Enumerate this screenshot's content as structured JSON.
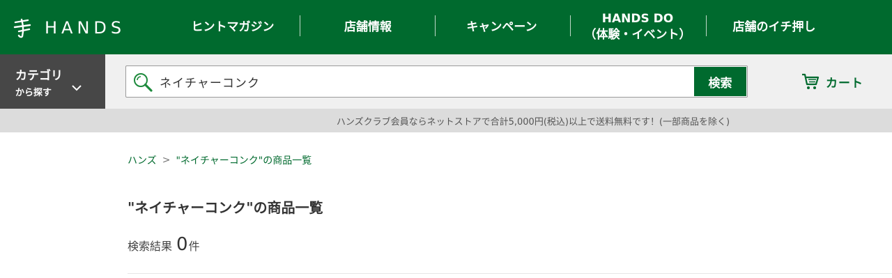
{
  "header": {
    "logo_text": "HANDS",
    "nav": [
      {
        "label": "ヒントマガジン",
        "sub": ""
      },
      {
        "label": "店舗情報",
        "sub": ""
      },
      {
        "label": "キャンペーン",
        "sub": ""
      },
      {
        "label": "HANDS DO",
        "sub": "（体験・イベント）"
      },
      {
        "label": "店舗のイチ押し",
        "sub": ""
      }
    ]
  },
  "category": {
    "title": "カテゴリ",
    "subtitle": "から探す"
  },
  "search": {
    "value": "ネイチャーコンク",
    "button_label": "検索"
  },
  "cart": {
    "label": "カート"
  },
  "notice": "ハンズクラブ会員ならネットストアで合計5,000円(税込)以上で送料無料です！(一部商品を除く)",
  "breadcrumb": {
    "home": "ハンズ",
    "separator": ">",
    "current": "\"ネイチャーコンク\"の商品一覧"
  },
  "page_title": "\"ネイチャーコンク\"の商品一覧",
  "results": {
    "label": "検索結果",
    "count": "0",
    "unit": "件"
  },
  "colors": {
    "brand_green": "#006a2e",
    "category_bg": "#474747",
    "notice_bg": "#dcdcdc"
  }
}
